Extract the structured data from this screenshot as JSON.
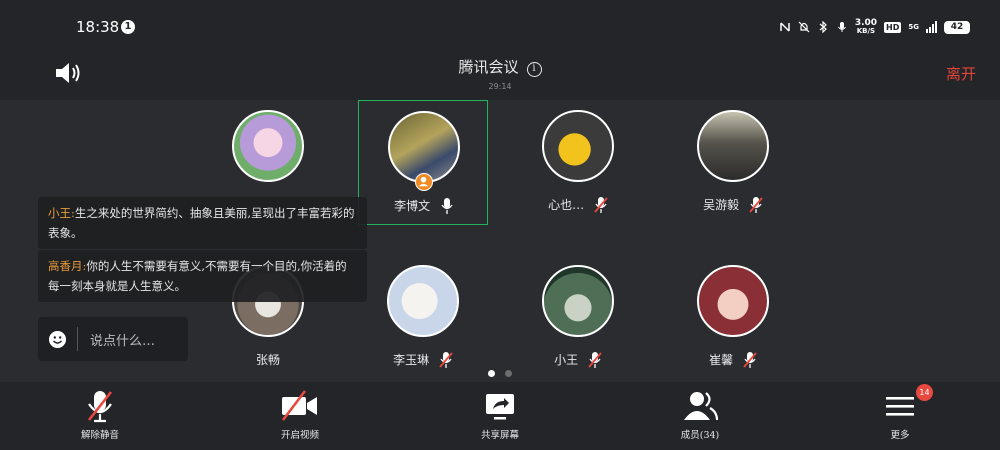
{
  "status_bar": {
    "time": "18:38",
    "notification_count": "1",
    "net_speed_value": "3.00",
    "net_speed_unit": "KB/S",
    "hd_label": "HD",
    "network_label": "5G",
    "battery": "42"
  },
  "header": {
    "title": "腾讯会议",
    "duration": "29:14",
    "leave_label": "离开"
  },
  "participants": [
    {
      "name": "",
      "muted": true
    },
    {
      "name": "李博文",
      "muted": false,
      "host": true,
      "active": true
    },
    {
      "name": "心也…",
      "muted": true
    },
    {
      "name": "吴游毅",
      "muted": true
    },
    {
      "name": "张畅",
      "muted": false
    },
    {
      "name": "李玉琳",
      "muted": true
    },
    {
      "name": "小王",
      "muted": true
    },
    {
      "name": "崔馨",
      "muted": true
    }
  ],
  "chat": {
    "messages": [
      {
        "sender": "小王:",
        "text": "生之来处的世界简约、抽象且美丽,呈现出了丰富若彩的表象。"
      },
      {
        "sender": "高香月:",
        "text": "你的人生不需要有意义,不需要有一个目的,你活着的每一刻本身就是人生意义。"
      }
    ],
    "placeholder": "说点什么…"
  },
  "pagination": {
    "pages": 2,
    "current": 1
  },
  "toolbar": {
    "unmute_label": "解除静音",
    "video_label": "开启视频",
    "share_label": "共享屏幕",
    "members_label": "成员(34)",
    "more_label": "更多",
    "more_badge": "14"
  },
  "colors": {
    "accent_green": "#22b35e",
    "leave_red": "#e0443a",
    "mute_red": "#e8493f",
    "sender_orange": "#e89b3b"
  }
}
